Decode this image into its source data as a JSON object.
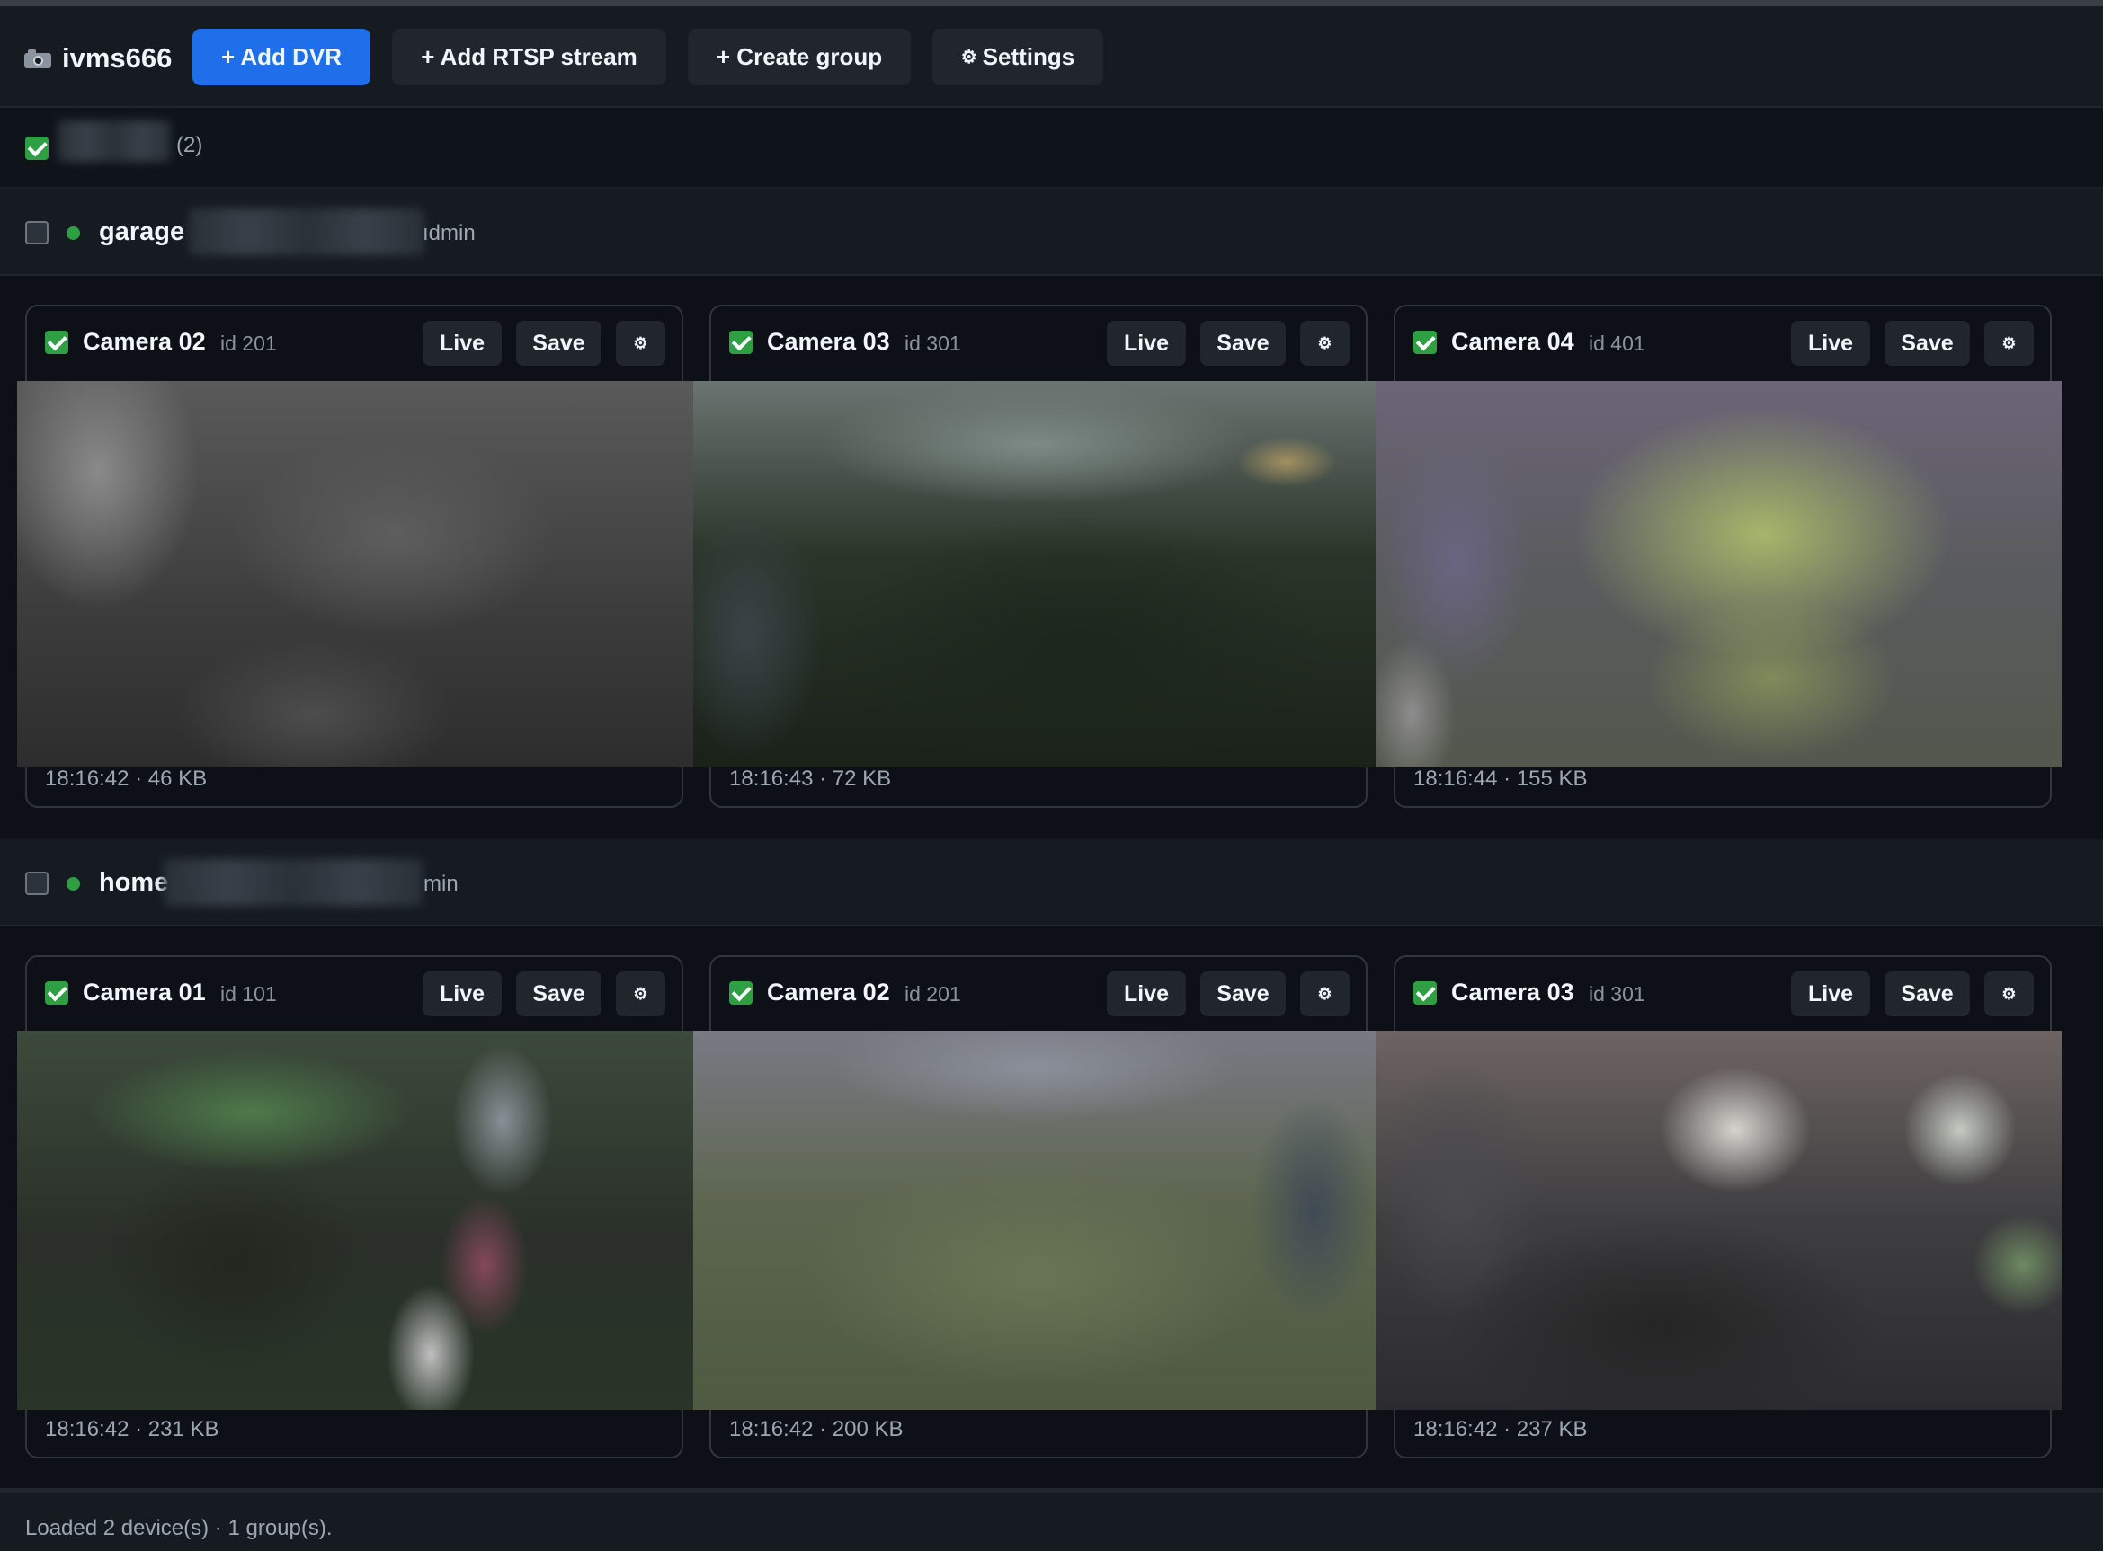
{
  "header": {
    "app_name": "ivms666",
    "buttons": {
      "add_dvr": "+ Add DVR",
      "add_rtsp": "+ Add RTSP stream",
      "create_group": "+ Create group",
      "settings_icon": "⚙",
      "settings": "Settings"
    }
  },
  "group": {
    "count": "(2)",
    "checked": true
  },
  "devices": [
    {
      "name": "garage",
      "user_suffix": "ıdmin",
      "online": true,
      "cameras": [
        {
          "name": "Camera 02",
          "id": "id 201",
          "checked": true,
          "time": "18:16:42",
          "size": "46 KB",
          "footer": "18:16:42 · 46 KB"
        },
        {
          "name": "Camera 03",
          "id": "id 301",
          "checked": true,
          "time": "18:16:43",
          "size": "72 KB",
          "footer": "18:16:43 · 72 KB"
        },
        {
          "name": "Camera 04",
          "id": "id 401",
          "checked": true,
          "time": "18:16:44",
          "size": "155 KB",
          "footer": "18:16:44 · 155 KB"
        }
      ]
    },
    {
      "name": "home",
      "user_suffix": "min",
      "online": true,
      "cameras": [
        {
          "name": "Camera 01",
          "id": "id 101",
          "checked": true,
          "time": "18:16:42",
          "size": "231 KB",
          "footer": "18:16:42 · 231 KB"
        },
        {
          "name": "Camera 02",
          "id": "id 201",
          "checked": true,
          "time": "18:16:42",
          "size": "200 KB",
          "footer": "18:16:42 · 200 KB"
        },
        {
          "name": "Camera 03",
          "id": "id 301",
          "checked": true,
          "time": "18:16:42",
          "size": "237 KB",
          "footer": "18:16:42 · 237 KB"
        }
      ]
    }
  ],
  "camera_buttons": {
    "live": "Live",
    "save": "Save",
    "settings_icon": "⚙"
  },
  "status": {
    "text": "Loaded 2 device(s) · 1 group(s)."
  },
  "colors": {
    "background": "#0d1117",
    "panel": "#161b22",
    "primary_button": "#1f6feb",
    "checkbox_checked": "#2ea043",
    "online_dot": "#2ea043"
  }
}
